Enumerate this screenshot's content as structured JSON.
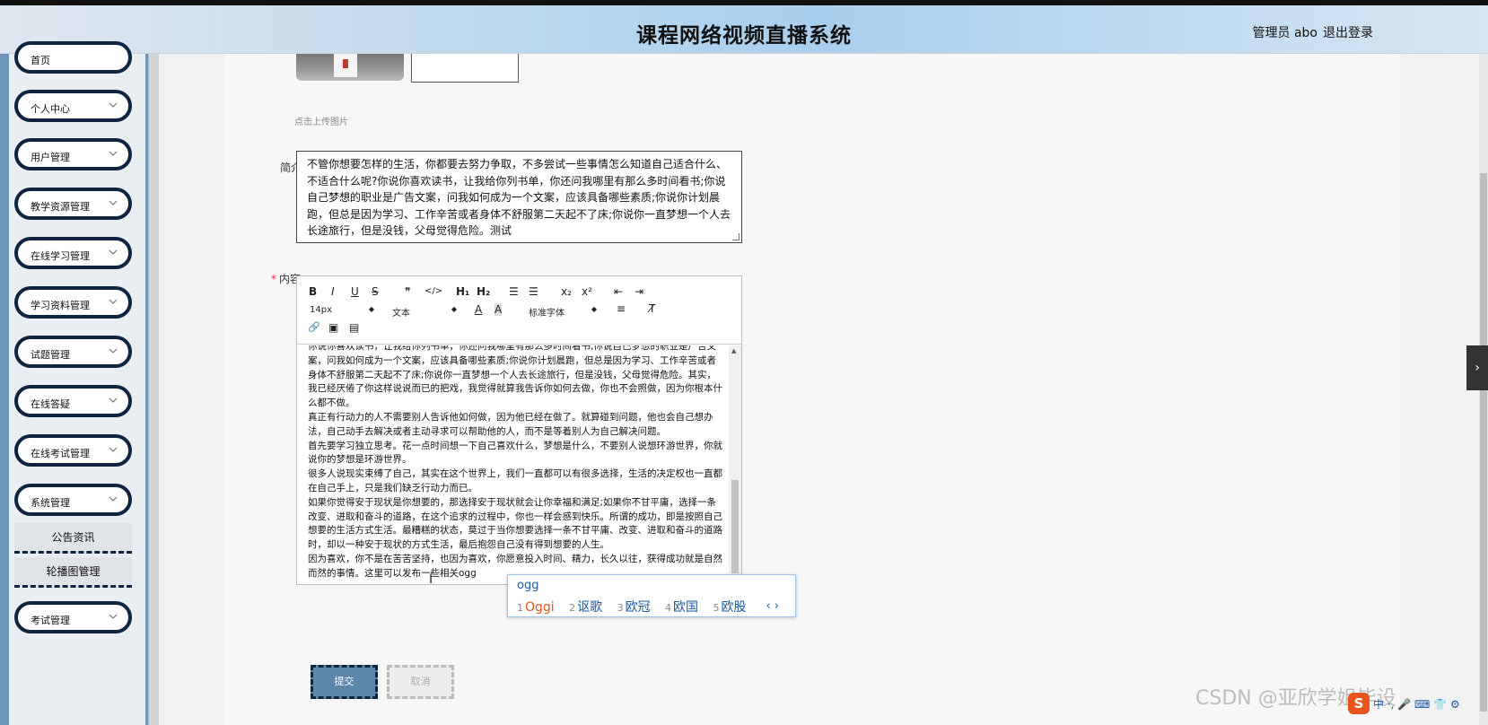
{
  "header": {
    "title": "课程网络视频直播系统",
    "user": "管理员 abo",
    "logout": "退出登录"
  },
  "sidebar": {
    "items": [
      {
        "label": "首页"
      },
      {
        "label": "个人中心"
      },
      {
        "label": "用户管理"
      },
      {
        "label": "教学资源管理"
      },
      {
        "label": "在线学习管理"
      },
      {
        "label": "学习资料管理"
      },
      {
        "label": "试题管理"
      },
      {
        "label": "在线答疑"
      },
      {
        "label": "在线考试管理"
      },
      {
        "label": "系统管理"
      },
      {
        "label": "考试管理"
      }
    ],
    "subitems": [
      {
        "label": "公告资讯"
      },
      {
        "label": "轮播图管理"
      }
    ]
  },
  "form": {
    "upload_hint": "点击上传图片",
    "intro_label": "简介",
    "intro_text": "不管你想要怎样的生活，你都要去努力争取，不多尝试一些事情怎么知道自己适合什么、不适合什么呢?你说你喜欢读书，让我给你列书单，你还问我哪里有那么多时间看书;你说自己梦想的职业是广告文案，问我如何成为一个文案，应该具备哪些素质;你说你计划晨跑，但总是因为学习、工作辛苦或者身体不舒服第二天起不了床;你说你一直梦想一个人去长途旅行，但是没钱，父母觉得危险。测试",
    "content_label": "内容",
    "required_mark": "*",
    "submit": "提交",
    "cancel": "取消"
  },
  "editor": {
    "toolbar": {
      "bold": "B",
      "italic": "I",
      "underline": "U",
      "strike": "S",
      "quote": "❞",
      "code": "</>",
      "h1": "H₁",
      "h2": "H₂",
      "ol": "☰",
      "ul": "☰",
      "sub": "x₂",
      "sup": "x²",
      "outdent": "⇤",
      "indent": "⇥",
      "font_size": "14px",
      "text_type": "文本",
      "font_family": "标准字体",
      "color": "A",
      "bg": "A",
      "align": "≡",
      "clear": "T̸",
      "link": "🔗",
      "image": "▣",
      "video": "▤"
    },
    "content": "你说你喜欢读书，让我给你列书单，你还问我哪里有那么多时间看书;你说自己梦想的职业是广告文案，问我如何成为一个文案，应该具备哪些素质;你说你计划晨跑，但总是因为学习、工作辛苦或者身体不舒服第二天起不了床;你说你一直梦想一个人去长途旅行，但是没钱，父母觉得危险。其实，我已经厌倦了你这样说说而已的把戏，我觉得就算我告诉你如何去做，你也不会照做，因为你根本什么都不做。\n真正有行动力的人不需要别人告诉他如何做，因为他已经在做了。就算碰到问题，他也会自己想办法，自己动手去解决或者主动寻求可以帮助他的人，而不是等着别人为自己解决问题。\n首先要学习独立思考。花一点时间想一下自己喜欢什么，梦想是什么，不要别人说想环游世界，你就说你的梦想是环游世界。\n很多人说现实束缚了自己，其实在这个世界上，我们一直都可以有很多选择，生活的决定权也一直都在自己手上，只是我们缺乏行动力而已。\n如果你觉得安于现状是你想要的，那选择安于现状就会让你幸福和满足;如果你不甘平庸，选择一条改变、进取和奋斗的道路，在这个追求的过程中，你也一样会感到快乐。所谓的成功，即是按照自己想要的生活方式生活。最糟糕的状态，莫过于当你想要选择一条不甘平庸、改变、进取和奋斗的道路时，却以一种安于现状的方式生活，最后抱怨自己没有得到想要的人生。\n因为喜欢，你不是在苦苦坚持，也因为喜欢，你愿意投入时间、精力，长久以往，获得成功就是自然而然的事情。这里可以发布一些相关ogg"
  },
  "ime": {
    "input": "ogg",
    "candidates": [
      {
        "n": "1",
        "text": "Oggi"
      },
      {
        "n": "2",
        "text": "讴歌"
      },
      {
        "n": "3",
        "text": "欧冠"
      },
      {
        "n": "4",
        "text": "欧国"
      },
      {
        "n": "5",
        "text": "欧股"
      }
    ],
    "nav": "‹ ›"
  },
  "watermark": "CSDN @亚欣学姐毕设",
  "tray": {
    "logo": "S",
    "text": "中 ·, 🎤 ⌨ 👕 ⚙"
  },
  "side_tab": "›"
}
